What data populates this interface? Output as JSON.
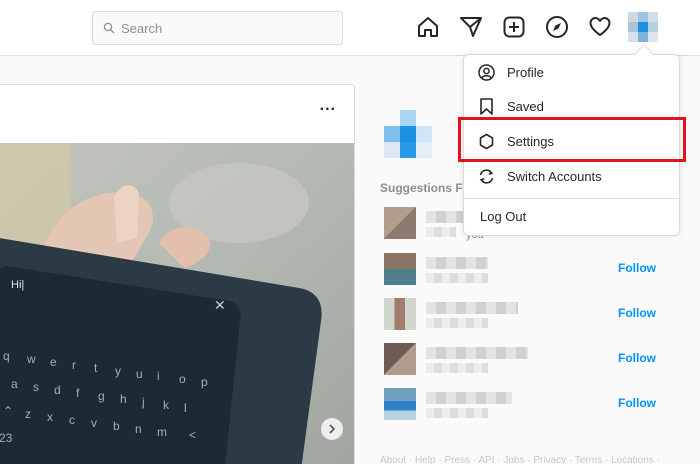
{
  "search": {
    "placeholder": "Search"
  },
  "nav_icons": [
    "home-icon",
    "direct-message-icon",
    "new-post-icon",
    "explore-icon",
    "activity-heart-icon"
  ],
  "post": {
    "more_label": "...",
    "screen_text": "Hi|"
  },
  "sidebar": {
    "suggestions_title": "Suggestions F",
    "you_fragment": "you",
    "follow_label": "Follow",
    "footer": "About · Help · Press · API · Jobs · Privacy · Terms · Locations ·"
  },
  "menu": {
    "items": [
      {
        "label": "Profile",
        "icon": "profile-icon"
      },
      {
        "label": "Saved",
        "icon": "bookmark-icon"
      },
      {
        "label": "Settings",
        "icon": "settings-gear-icon"
      },
      {
        "label": "Switch Accounts",
        "icon": "switch-accounts-icon"
      }
    ],
    "logout_label": "Log Out"
  },
  "colors": {
    "accent": "#0095f6",
    "highlight": "#e0141d",
    "border": "#dbdbdb",
    "muted": "#8e8e8e"
  }
}
